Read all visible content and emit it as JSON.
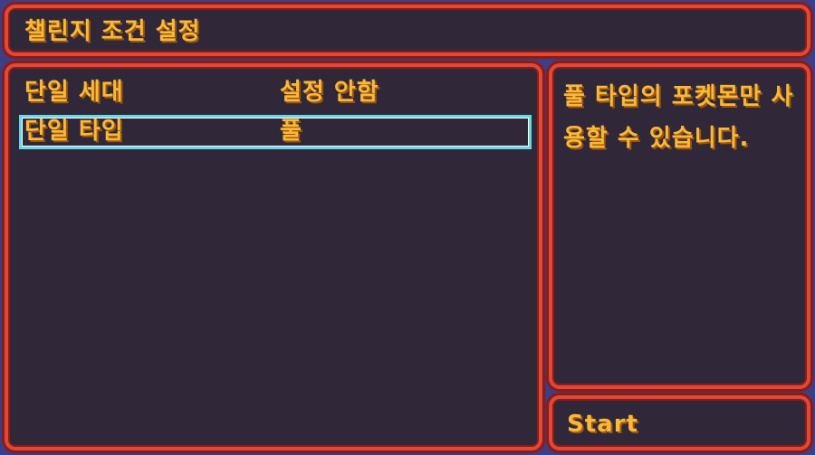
{
  "header": {
    "title": "챌린지 조건 설정"
  },
  "conditions": [
    {
      "label": "단일 세대",
      "value": "설정 안함",
      "selected": false
    },
    {
      "label": "단일 타입",
      "value": "풀",
      "selected": true
    }
  ],
  "description": {
    "text": "풀 타입의 포켓몬만 사용할 수 있습니다."
  },
  "start": {
    "label": "Start"
  },
  "colors": {
    "panel_bg": "#302839",
    "border": "#e04838",
    "text": "#f8b838",
    "selection": "#68d8e8",
    "background": "#3c3e86"
  }
}
